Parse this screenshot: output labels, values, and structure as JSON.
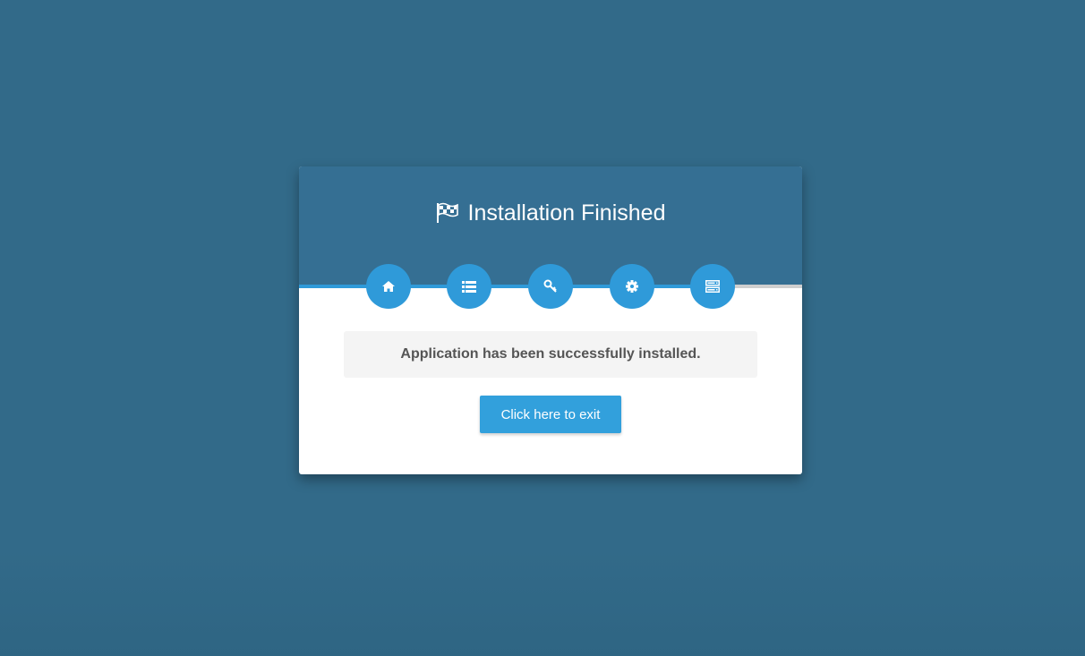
{
  "header": {
    "title": "Installation Finished",
    "title_icon": "checkered-flag-icon"
  },
  "steps": [
    {
      "icon": "home-icon",
      "completed": true
    },
    {
      "icon": "list-icon",
      "completed": true
    },
    {
      "icon": "key-icon",
      "completed": true
    },
    {
      "icon": "gear-icon",
      "completed": true
    },
    {
      "icon": "server-icon",
      "completed": true
    }
  ],
  "message": "Application has been successfully installed.",
  "exit_button": {
    "label": "Click here to exit"
  },
  "colors": {
    "page_background": "#326a89",
    "header_background": "#356f93",
    "accent": "#2f9ad9",
    "message_text": "#555555"
  }
}
